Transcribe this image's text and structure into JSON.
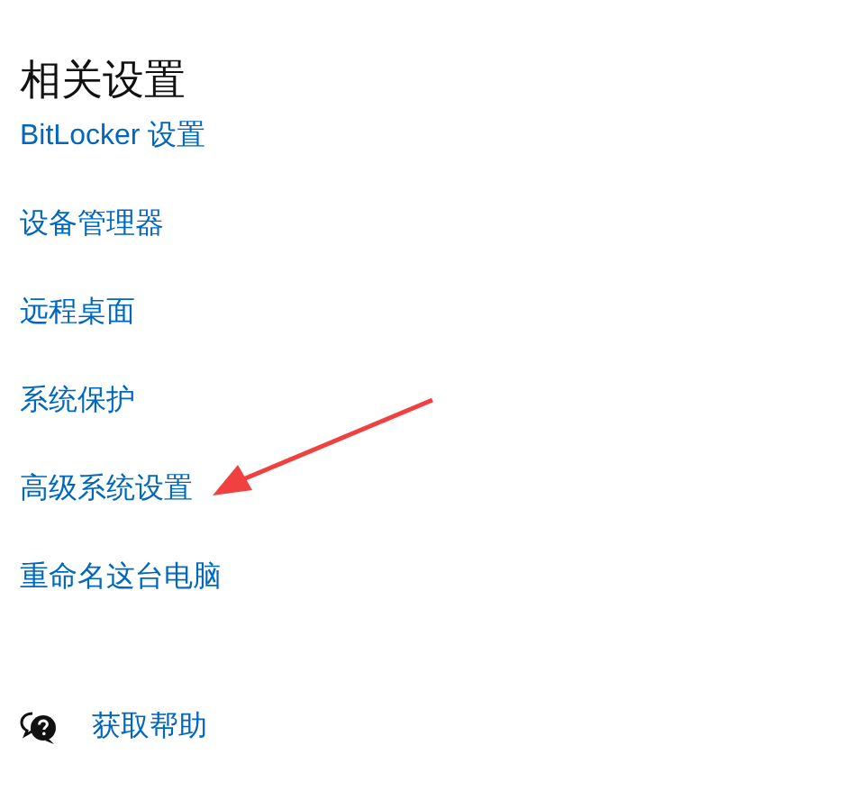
{
  "section": {
    "title": "相关设置"
  },
  "links": [
    {
      "label": "BitLocker 设置"
    },
    {
      "label": "设备管理器"
    },
    {
      "label": "远程桌面"
    },
    {
      "label": "系统保护"
    },
    {
      "label": "高级系统设置"
    },
    {
      "label": "重命名这台电脑"
    }
  ],
  "help": {
    "label": "获取帮助"
  }
}
